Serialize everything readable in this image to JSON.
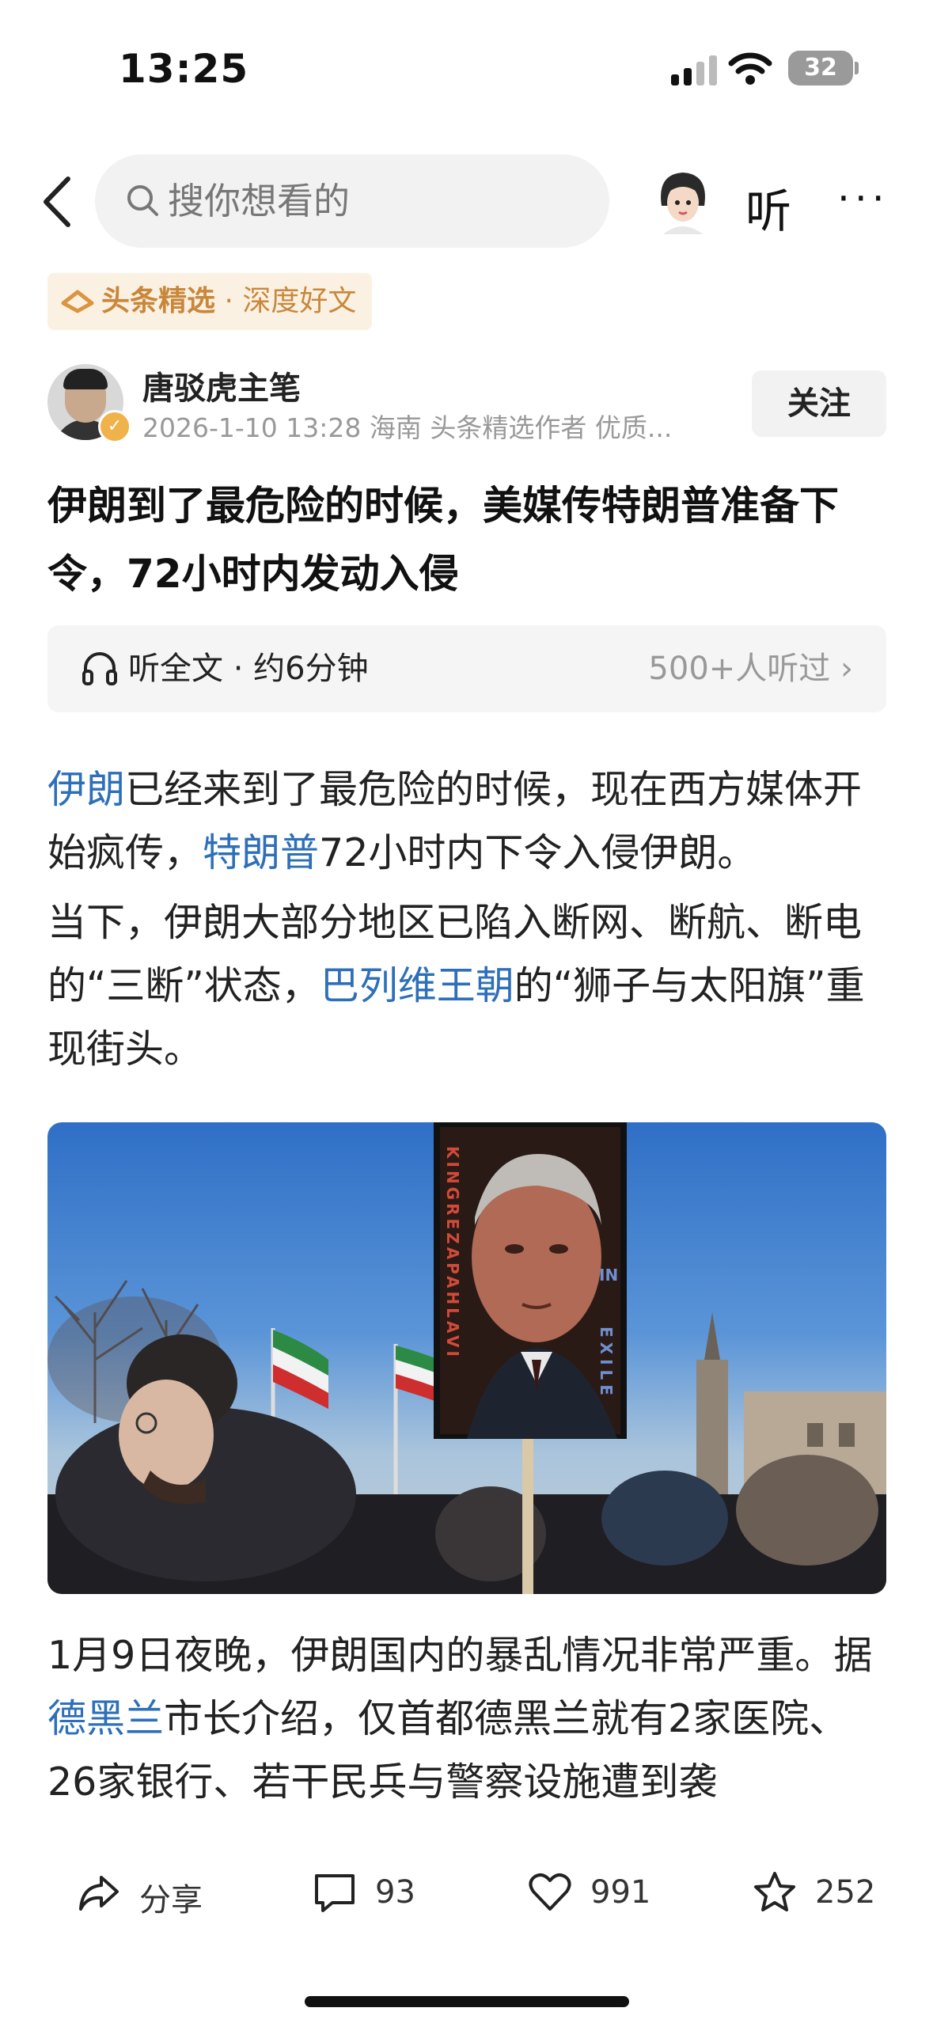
{
  "status_bar": {
    "time": "13:25",
    "battery": "32"
  },
  "nav": {
    "search_placeholder": "搜你想看的",
    "listen_label": "听",
    "more_label": "···"
  },
  "badge": {
    "brand": "头条精选",
    "separator": " · ",
    "tag": "深度好文"
  },
  "author": {
    "name": "唐驳虎主笔",
    "meta": "2026-1-10  13:28  海南  头条精选作者 优质...",
    "follow_label": "关注"
  },
  "article": {
    "title": "伊朗到了最危险的时候，美媒传特朗普准备下令，72小时内发动入侵",
    "listen_full": "听全文 · 约6分钟",
    "listen_count": "500+人听过 ›",
    "p1": {
      "link1": "伊朗",
      "text1": "已经来到了最危险的时候，现在西方媒体开始疯传，",
      "link2": "特朗普",
      "text2": "72小时内下令入侵伊朗。"
    },
    "p2": {
      "text1": "当下，伊朗大部分地区已陷入断网、断航、断电的“三断”状态，",
      "link1": "巴列维王朝",
      "text2": "的“狮子与太阳旗”重现街头。"
    },
    "photo": {
      "sign_vertical": "KINGREZAPAHLAVI",
      "sign_in": "IN",
      "sign_exile": "EXILE"
    },
    "p3": {
      "text1": "1月9日夜晚，伊朗国内的暴乱情况非常严重。据",
      "link1": "德黑兰",
      "text2": "市长介绍，仅首都德黑兰就有2家医院、26家银行、若干民兵与警察设施遭到袭"
    }
  },
  "actions": {
    "share": "分享",
    "comments": "93",
    "likes": "991",
    "favorites": "252"
  },
  "colors": {
    "link": "#2d6fb8",
    "badge_text": "#c9873a",
    "badge_bg": "#fbf1e3"
  }
}
